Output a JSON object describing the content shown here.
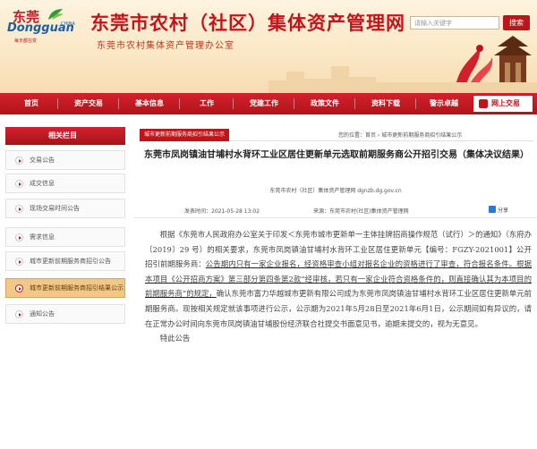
{
  "header": {
    "logo_cn": "东莞",
    "logo_en": "Dongguan",
    "logo_tag": "CHINA",
    "logo_slogan": "每天都在变",
    "site_title": "东莞市农村（社区）集体资产管理网",
    "site_subtitle": "东莞市农村集体资产管理办公室",
    "search_placeholder": "请输入关键字",
    "search_button": "搜索"
  },
  "nav": {
    "items": [
      "首页",
      "资产交易",
      "基本信息",
      "工作",
      "党建工作",
      "政策文件",
      "资料下载",
      "警示卓越"
    ],
    "login": "网上交易"
  },
  "sidebar": {
    "title": "相关栏目",
    "items": [
      {
        "label": "交易公告",
        "active": false
      },
      {
        "label": "成交信息",
        "active": false
      },
      {
        "label": "现场交易时间公告",
        "active": false
      },
      {
        "label": "需求信息",
        "active": false
      },
      {
        "label": "城市更新前期服务商招引公告",
        "active": false
      },
      {
        "label": "城市更新前期服务商招引结果公示",
        "active": true
      },
      {
        "label": "通知公告",
        "active": false
      }
    ]
  },
  "main": {
    "category_tag": "城市更新前期服务商招引结果公示",
    "breadcrumb": "您的位置：首页 › 城市更新前期服务商招引结果公示",
    "title": "东莞市凤岗镇油甘埔村水背环工业区居住更新单元选取前期服务商公开招引交易（集体决议结果）",
    "source": "东莞市农村（社区）集体资产管理网  dgnzb.dg.gov.cn",
    "publish_time": "发表时间：2021-05-28 13:02",
    "origin": "来源：东莞市农村(社区)集体资产管理网",
    "share": "分享",
    "para1_a": "根据《东莞市人民政府办公室关于印发＜东莞市城市更新单一主体挂牌招商操作规范（试行）＞的通知》（东府办〔2019〕29 号）的相关要求，东莞市凤岗镇油甘埔村水背环工业区居住更新单元【编号：FGZY-2021001】公开招引前期服务商：",
    "para1_hl": "公告期内只有一家企业报名，经资格审查小组对报名企业的资格进行了审查，符合报名条件。根据本项目《公开招商方案》第三部分第四条第2款“经审核，若只有一家企业符合资格条件的，则直接确认其为本项目的前期服务商”的规定，",
    "para1_b": "确认东莞市富力华越城市更新有限公司成为东莞市凤岗镇油甘埔村水背环工业区居住更新单元前期服务商。现按相关规定就该事项进行公示，公示期为2021年5月28日至2021年6月1日，公示期间如有异议的，请在正常办公时间向东莞市凤岗镇油甘埔股份经济联合社提交书面意见书，逾期未提交的，视为无意见。",
    "closing": "特此公告"
  },
  "colors": {
    "brand_red": "#c4141b",
    "header_bg": "#fbe7c4",
    "active_item": "#f0c88a"
  }
}
